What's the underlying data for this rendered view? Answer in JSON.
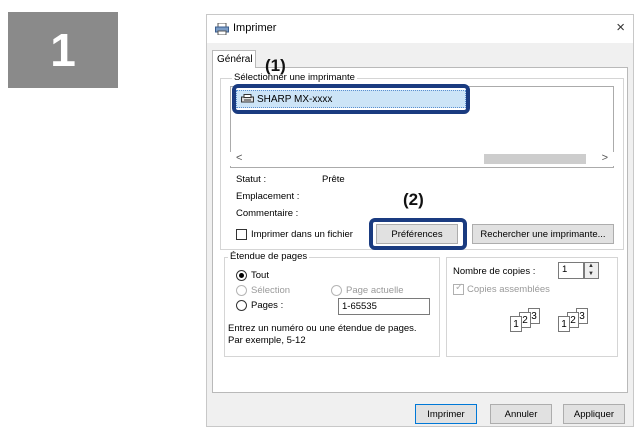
{
  "step": {
    "number": "1"
  },
  "window": {
    "title": "Imprimer",
    "close": "×"
  },
  "tabs": [
    {
      "label": "Général"
    }
  ],
  "printer_select": {
    "group_label": "Sélectionner une imprimante",
    "selected_printer": "SHARP MX-xxxx"
  },
  "status": {
    "statut_label": "Statut :",
    "statut_value": "Prête",
    "emplacement_label": "Emplacement :",
    "commentaire_label": "Commentaire :"
  },
  "print_to_file_label": "Imprimer dans un fichier",
  "buttons": {
    "preferences": "Préférences",
    "find_printer": "Rechercher une imprimante...",
    "print": "Imprimer",
    "cancel": "Annuler",
    "apply": "Appliquer"
  },
  "page_range": {
    "group_label": "Étendue de pages",
    "all": "Tout",
    "selection": "Sélection",
    "current_page": "Page actuelle",
    "pages": "Pages :",
    "pages_value": "1-65535",
    "hint_line1": "Entrez un numéro ou une étendue de pages.",
    "hint_line2": "Par exemple, 5-12"
  },
  "copies": {
    "label": "Nombre de copies :",
    "value": "1",
    "collate_label": "Copies assemblées",
    "collate_checked": true
  },
  "callouts": {
    "one": "(1)",
    "two": "(2)"
  },
  "colors": {
    "callout_border": "#1a3b80",
    "selected_row": "#cce4f7",
    "badge": "#8a8a8a"
  }
}
